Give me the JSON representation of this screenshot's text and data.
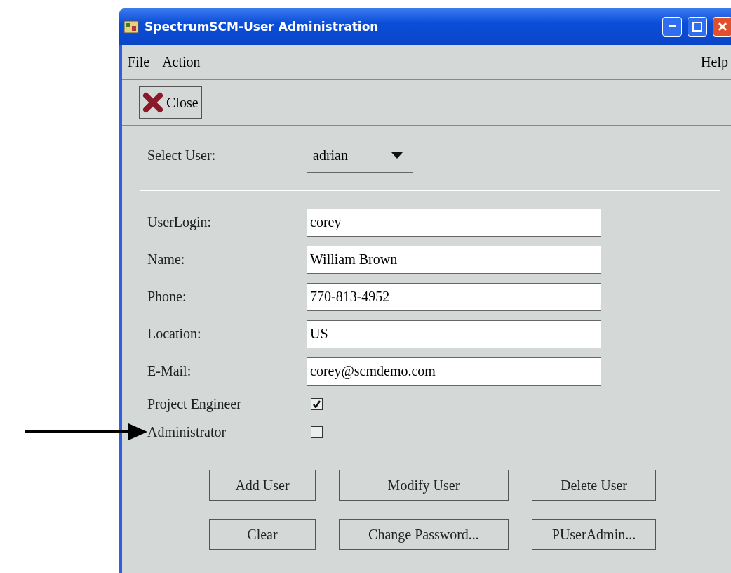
{
  "window": {
    "title": "SpectrumSCM-User Administration"
  },
  "menu": {
    "left": [
      "File",
      "Action"
    ],
    "right": [
      "Help"
    ]
  },
  "toolbar": [
    {
      "label": "Close"
    }
  ],
  "select_user": {
    "label": "Select User:",
    "value": "adrian"
  },
  "fields": [
    {
      "label": "UserLogin:",
      "value": "corey"
    },
    {
      "label": "Name:",
      "value": "William Brown"
    },
    {
      "label": "Phone:",
      "value": "770-813-4952"
    },
    {
      "label": "Location:",
      "value": "US"
    },
    {
      "label": "E-Mail:",
      "value": "corey@scmdemo.com"
    }
  ],
  "roles": [
    {
      "label": "Project Engineer",
      "checked": true,
      "pointed": false
    },
    {
      "label": "Administrator",
      "checked": false,
      "pointed": true
    }
  ],
  "buttons": [
    [
      "Add User",
      "Modify User",
      "Delete User"
    ],
    [
      "Clear",
      "Change Password...",
      "PUserAdmin..."
    ]
  ]
}
